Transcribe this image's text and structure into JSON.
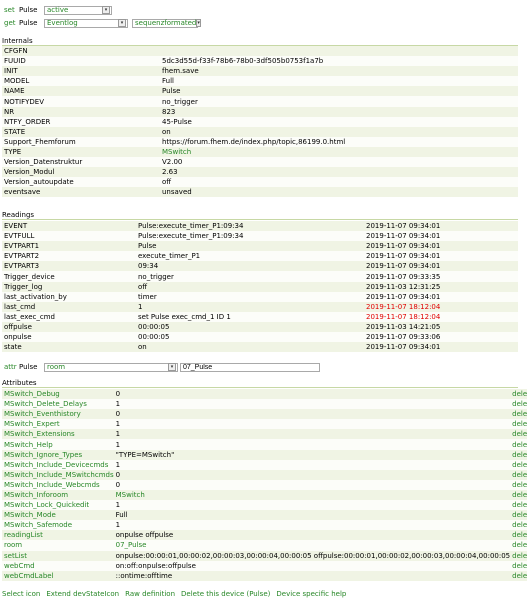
{
  "set_cmd": {
    "link": "set",
    "device": "Pulse",
    "value": "active"
  },
  "get_cmd": {
    "link": "get",
    "device": "Pulse",
    "value": "Eventlog",
    "format": "sequenzformated"
  },
  "internals": {
    "title": "Internals",
    "rows": [
      {
        "name": "CFGFN",
        "value": ""
      },
      {
        "name": "FUUID",
        "value": "5dc3d55d-f33f-78b6-78b0-3df505b0753f1a7b"
      },
      {
        "name": "INIT",
        "value": "fhem.save"
      },
      {
        "name": "MODEL",
        "value": "Full"
      },
      {
        "name": "NAME",
        "value": "Pulse"
      },
      {
        "name": "NOTIFYDEV",
        "value": "no_trigger"
      },
      {
        "name": "NR",
        "value": "823"
      },
      {
        "name": "NTFY_ORDER",
        "value": "45-Pulse"
      },
      {
        "name": "STATE",
        "value": "on"
      },
      {
        "name": "Support_Fhemforum",
        "value": "https://forum.fhem.de/index.php/topic,86199.0.html"
      },
      {
        "name": "TYPE",
        "value": "MSwitch",
        "link": true
      },
      {
        "name": "Version_Datenstruktur",
        "value": "V2.00"
      },
      {
        "name": "Version_Modul",
        "value": "2.63"
      },
      {
        "name": "Version_autoupdate",
        "value": "off"
      },
      {
        "name": "eventsave",
        "value": "unsaved"
      }
    ]
  },
  "readings": {
    "title": "Readings",
    "rows": [
      {
        "name": "EVENT",
        "value": "Pulse:execute_timer_P1:09:34",
        "time": "2019-11-07 09:34:01"
      },
      {
        "name": "EVTFULL",
        "value": "Pulse:execute_timer_P1:09:34",
        "time": "2019-11-07 09:34:01"
      },
      {
        "name": "EVTPART1",
        "value": "Pulse",
        "time": "2019-11-07 09:34:01"
      },
      {
        "name": "EVTPART2",
        "value": "execute_timer_P1",
        "time": "2019-11-07 09:34:01"
      },
      {
        "name": "EVTPART3",
        "value": "09:34",
        "time": "2019-11-07 09:34:01"
      },
      {
        "name": "Trigger_device",
        "value": "no_trigger",
        "time": "2019-11-07 09:33:35"
      },
      {
        "name": "Trigger_log",
        "value": "off",
        "time": "2019-11-03 12:31:25"
      },
      {
        "name": "last_activation_by",
        "value": "timer",
        "time": "2019-11-07 09:34:01"
      },
      {
        "name": "last_cmd",
        "value": "1",
        "time": "2019-11-07 18:12:04",
        "red": true
      },
      {
        "name": "last_exec_cmd",
        "value": "set Pulse exec_cmd_1 ID 1",
        "time": "2019-11-07 18:12:04",
        "red": true
      },
      {
        "name": "offpulse",
        "value": "00:00:05",
        "time": "2019-11-03 14:21:05"
      },
      {
        "name": "onpulse",
        "value": "00:00:05",
        "time": "2019-11-07 09:33:06"
      },
      {
        "name": "state",
        "value": "on",
        "time": "2019-11-07 09:34:01"
      }
    ]
  },
  "attr_cmd": {
    "link": "attr",
    "device": "Pulse",
    "value": "room",
    "input": "07_Pulse"
  },
  "attributes": {
    "title": "Attributes",
    "delete_label": "deleteattr",
    "rows": [
      {
        "name": "MSwitch_Debug",
        "value": "0"
      },
      {
        "name": "MSwitch_Delete_Delays",
        "value": "1"
      },
      {
        "name": "MSwitch_Eventhistory",
        "value": "0"
      },
      {
        "name": "MSwitch_Expert",
        "value": "1"
      },
      {
        "name": "MSwitch_Extensions",
        "value": "1"
      },
      {
        "name": "MSwitch_Help",
        "value": "1"
      },
      {
        "name": "MSwitch_Ignore_Types",
        "value": "\"TYPE=MSwitch\""
      },
      {
        "name": "MSwitch_Include_Devicecmds",
        "value": "1"
      },
      {
        "name": "MSwitch_Include_MSwitchcmds",
        "value": "0"
      },
      {
        "name": "MSwitch_Include_Webcmds",
        "value": "0"
      },
      {
        "name": "MSwitch_Inforoom",
        "value": "MSwitch",
        "link": true
      },
      {
        "name": "MSwitch_Lock_Quickedit",
        "value": "1"
      },
      {
        "name": "MSwitch_Mode",
        "value": "Full"
      },
      {
        "name": "MSwitch_Safemode",
        "value": "1"
      },
      {
        "name": "readingList",
        "value": "onpulse offpulse"
      },
      {
        "name": "room",
        "value": "07_Pulse",
        "link": true
      },
      {
        "name": "setList",
        "value": "onpulse:00:00:01,00:00:02,00:00:03,00:00:04,00:00:05 offpulse:00:00:01,00:00:02,00:00:03,00:00:04,00:00:05"
      },
      {
        "name": "webCmd",
        "value": "on:off:onpulse:offpulse"
      },
      {
        "name": "webCmdLabel",
        "value": "::ontime:offtime"
      }
    ]
  },
  "footer": [
    "Select icon",
    "Extend devStateIcon",
    "Raw definition",
    "Delete this device (Pulse)",
    "Device specific help"
  ]
}
